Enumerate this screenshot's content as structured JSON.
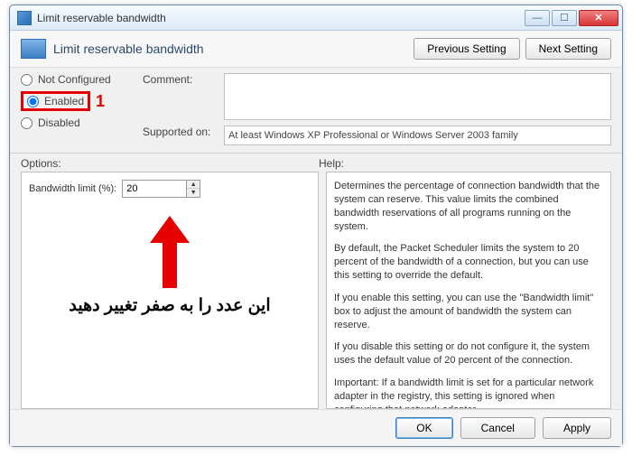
{
  "window": {
    "title": "Limit reservable bandwidth"
  },
  "header": {
    "heading": "Limit reservable bandwidth",
    "prev": "Previous Setting",
    "next": "Next Setting"
  },
  "radios": {
    "not_configured": "Not Configured",
    "enabled": "Enabled",
    "disabled": "Disabled",
    "selected": "enabled"
  },
  "annotation": {
    "marker": "1",
    "persian": "این عدد را به صفر تغییر دهید"
  },
  "fields": {
    "comment_label": "Comment:",
    "comment_value": "",
    "supported_label": "Supported on:",
    "supported_value": "At least Windows XP Professional or Windows Server 2003 family"
  },
  "panels": {
    "options_label": "Options:",
    "help_label": "Help:",
    "bandwidth_label": "Bandwidth limit (%):",
    "bandwidth_value": "20"
  },
  "help": {
    "p1": "Determines the percentage of connection bandwidth that the system can reserve. This value limits the combined bandwidth reservations of all programs running on the system.",
    "p2": "By default, the Packet Scheduler limits the system to 20 percent of the bandwidth of a connection, but you can use this setting to override the default.",
    "p3": "If you enable this setting, you can use the \"Bandwidth limit\" box to adjust the amount of bandwidth the system can reserve.",
    "p4": "If you disable this setting or do not configure it, the system uses the default value of 20 percent of the connection.",
    "p5": "Important: If a bandwidth limit is set for a particular network adapter in the registry, this setting is ignored when configuring that network adapter."
  },
  "footer": {
    "ok": "OK",
    "cancel": "Cancel",
    "apply": "Apply"
  }
}
